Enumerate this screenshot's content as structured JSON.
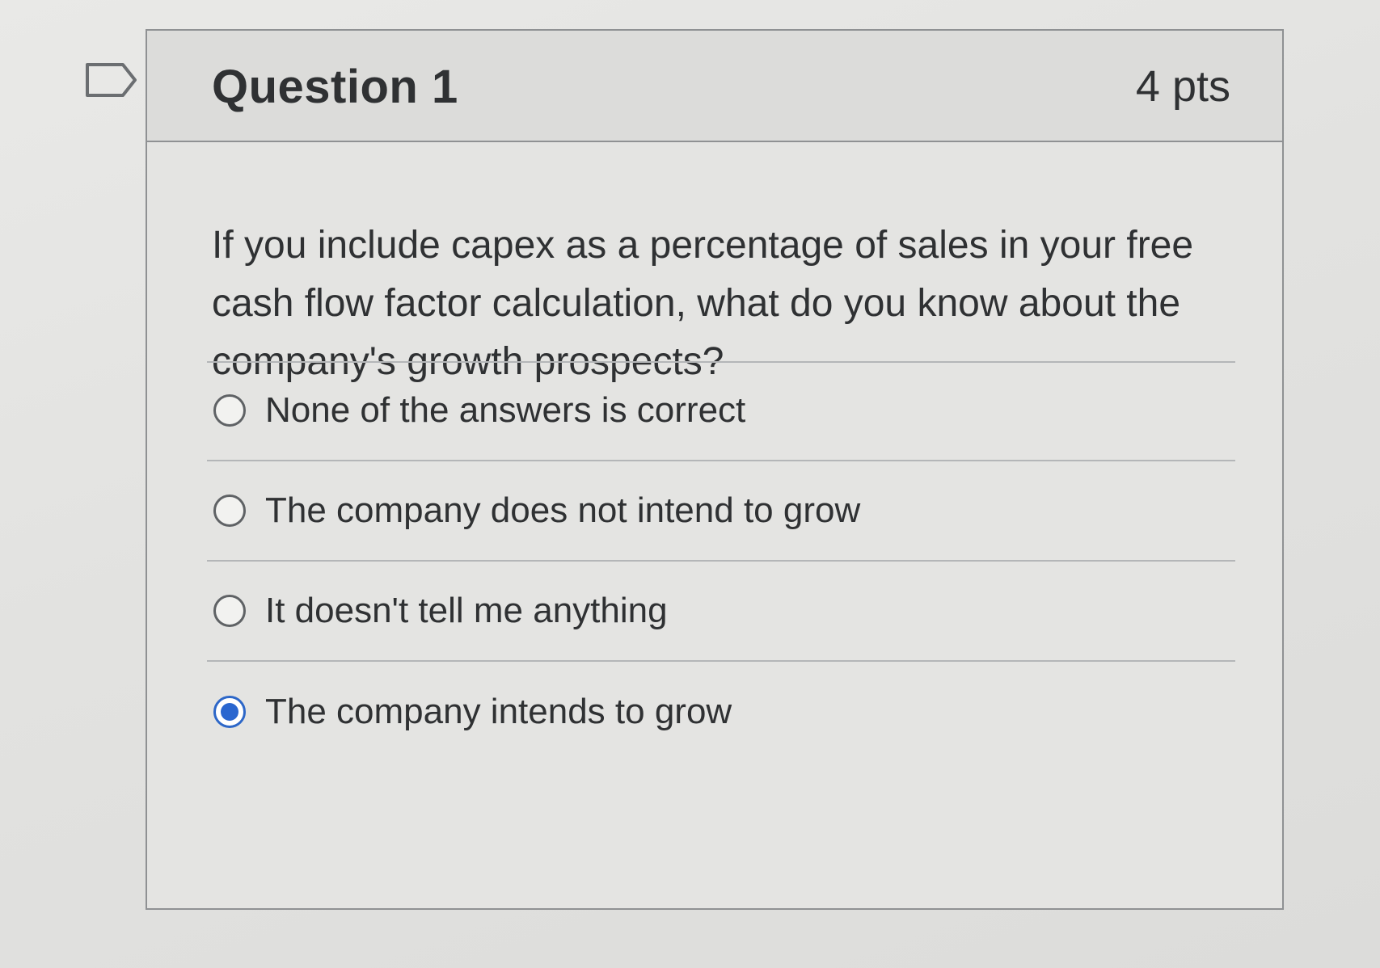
{
  "question": {
    "title": "Question 1",
    "points": "4 pts",
    "text": "If  you include capex as a percentage of sales in your free cash flow factor calculation, what do you know about the company's growth prospects?"
  },
  "flag": {
    "icon": "flag-icon"
  },
  "answers": [
    {
      "label": "None of the answers is correct",
      "selected": false
    },
    {
      "label": "The company does not intend to grow",
      "selected": false
    },
    {
      "label": "It doesn't tell me anything",
      "selected": false
    },
    {
      "label": "The company intends to grow",
      "selected": true
    }
  ],
  "colors": {
    "selected_radio": "#2a66cf",
    "border": "#8f9193",
    "text": "#2f3133"
  }
}
